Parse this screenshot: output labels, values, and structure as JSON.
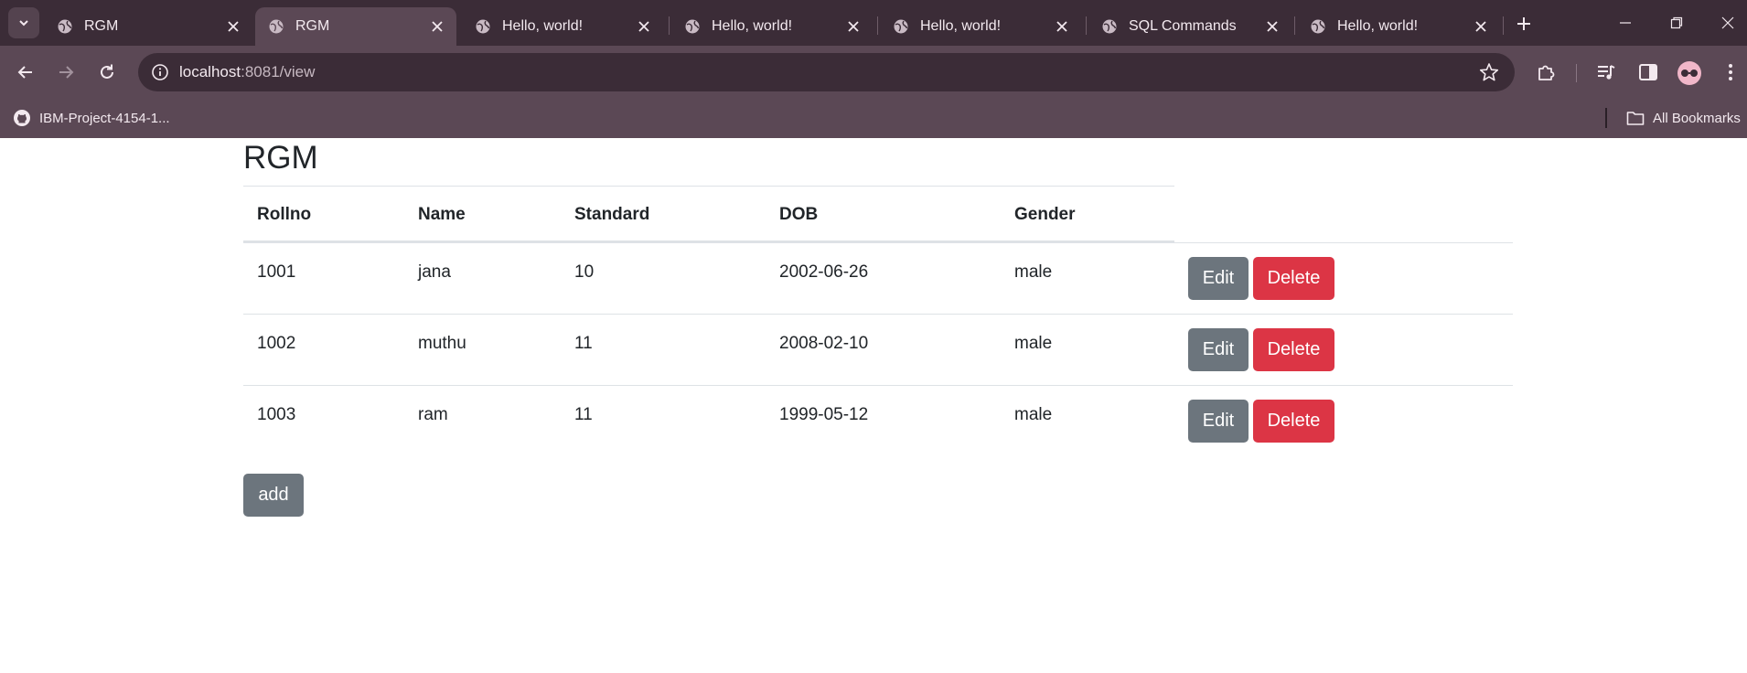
{
  "browser": {
    "tabs": [
      {
        "title": "RGM",
        "active": false
      },
      {
        "title": "RGM",
        "active": true
      },
      {
        "title": "Hello, world!",
        "active": false
      },
      {
        "title": "Hello, world!",
        "active": false
      },
      {
        "title": "Hello, world!",
        "active": false
      },
      {
        "title": "SQL Commands",
        "active": false
      },
      {
        "title": "Hello, world!",
        "active": false
      }
    ],
    "address": {
      "host": "localhost",
      "path": ":8081/view"
    },
    "bookmarks": [
      {
        "label": "IBM-Project-4154-1...",
        "icon": "github-icon"
      }
    ],
    "all_bookmarks_label": "All Bookmarks"
  },
  "page": {
    "title": "RGM",
    "columns": [
      "Rollno",
      "Name",
      "Standard",
      "DOB",
      "Gender"
    ],
    "rows": [
      [
        "1001",
        "jana",
        "10",
        "2002-06-26",
        "male"
      ],
      [
        "1002",
        "muthu",
        "11",
        "2008-02-10",
        "male"
      ],
      [
        "1003",
        "ram",
        "11",
        "1999-05-12",
        "male"
      ]
    ],
    "edit_label": "Edit",
    "delete_label": "Delete",
    "add_label": "add"
  },
  "colors": {
    "edit_button": "#6c757d",
    "delete_button": "#dc3545",
    "add_button": "#6c757d",
    "browser_frame": "#3b2c37",
    "browser_toolbar": "#5b4855"
  }
}
